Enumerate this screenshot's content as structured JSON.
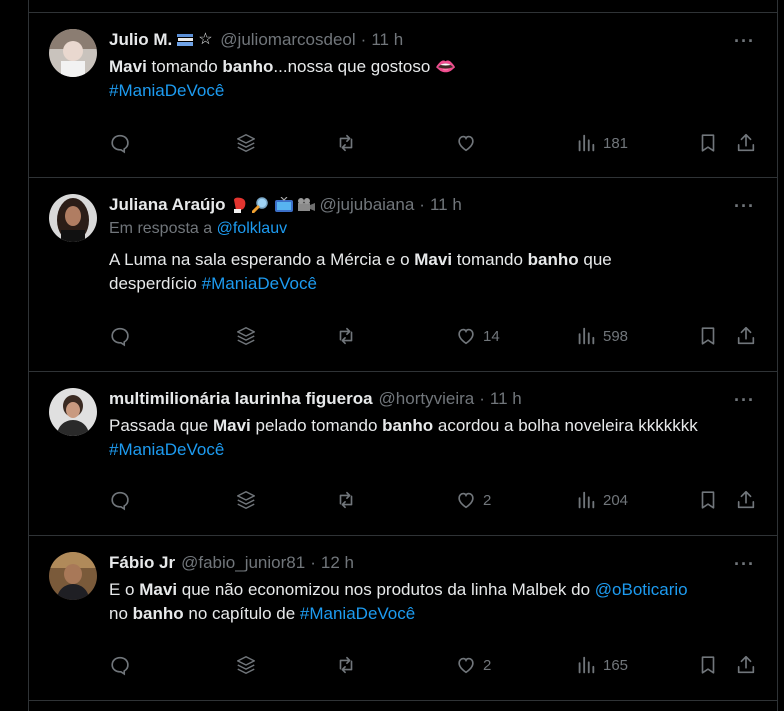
{
  "tweets": [
    {
      "name": "Julio M.",
      "badges": [
        "books-emoji",
        "star-emoji"
      ],
      "handle": "@juliomarcosdeol",
      "time": "11 h",
      "text": [
        {
          "t": "Mavi",
          "b": true
        },
        {
          "t": " tomando "
        },
        {
          "t": "banho",
          "b": true
        },
        {
          "t": "...nossa que gostoso "
        },
        {
          "t": "👄"
        }
      ],
      "text2": "#ManiaDeVocê",
      "views": "181"
    },
    {
      "name": "Juliana Araújo",
      "badges": [
        "boxing-glove-emoji",
        "magnifier-emoji",
        "tv-emoji",
        "camera-emoji"
      ],
      "handle": "@jujubaiana",
      "time": "11 h",
      "reply_prefix": "Em resposta a ",
      "reply_to": "@folklauv",
      "line1": [
        {
          "t": "A Luma na sala esperando a Mércia e o "
        },
        {
          "t": "Mavi",
          "b": true
        },
        {
          "t": " tomando "
        },
        {
          "t": "banho",
          "b": true
        },
        {
          "t": " que"
        }
      ],
      "line2_text": "desperdício ",
      "line2_hashtag": "#ManiaDeVocê",
      "likes": "14",
      "views": "598"
    },
    {
      "name": "multimilionária laurinha figueroa",
      "handle": "@hortyvieira",
      "time": "11 h",
      "line1": [
        {
          "t": "Passada que "
        },
        {
          "t": "Mavi",
          "b": true
        },
        {
          "t": " pelado tomando "
        },
        {
          "t": "banho",
          "b": true
        },
        {
          "t": " acordou a bolha noveleira kkkkkkk"
        }
      ],
      "text2": "#ManiaDeVocê",
      "likes": "2",
      "views": "204"
    },
    {
      "name": "Fábio Jr",
      "handle": "@fabio_junior81",
      "time": "12 h",
      "line1": [
        {
          "t": "E o "
        },
        {
          "t": "Mavi",
          "b": true
        },
        {
          "t": " que não economizou nos produtos da linha Malbek do "
        },
        {
          "t": "@oBoticario",
          "link": true
        }
      ],
      "line2": [
        {
          "t": "no "
        },
        {
          "t": "banho",
          "b": true
        },
        {
          "t": " no capítulo de "
        },
        {
          "t": "#ManiaDeVocê",
          "link": true
        }
      ],
      "likes": "2",
      "views": "165"
    }
  ],
  "separator_dot": "·",
  "more_label": "···",
  "colors": {
    "background": "#000000",
    "text": "#e7e9ea",
    "muted": "#71767b",
    "link": "#1d9bf0",
    "border": "#2f3336"
  }
}
